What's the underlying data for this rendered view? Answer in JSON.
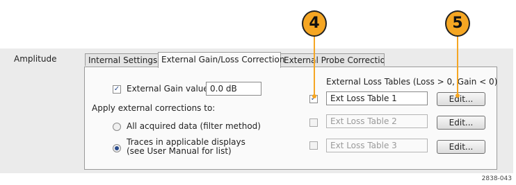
{
  "section_label": "Amplitude",
  "tabs": [
    {
      "label": "Internal Settings"
    },
    {
      "label": "External Gain/Loss Correction"
    },
    {
      "label": "External Probe Correction"
    }
  ],
  "gain": {
    "checkbox_label": "External Gain value:",
    "value": "0.0 dB"
  },
  "apply": {
    "heading": "Apply external corrections to:",
    "option1": "All acquired data (filter method)",
    "option2_line1": "Traces in applicable displays",
    "option2_line2": "(see User Manual for list)"
  },
  "loss_tables": {
    "header": "External Loss Tables (Loss > 0, Gain < 0)",
    "rows": [
      {
        "name": "Ext Loss Table 1",
        "button": "Edit..."
      },
      {
        "name": "Ext Loss Table 2",
        "button": "Edit..."
      },
      {
        "name": "Ext Loss Table 3",
        "button": "Edit..."
      }
    ]
  },
  "callouts": [
    "4",
    "5"
  ],
  "figure_id": "2838-043",
  "colors": {
    "callout": "#f5a623",
    "panel": "#ebebeb",
    "content": "#fafafa"
  }
}
